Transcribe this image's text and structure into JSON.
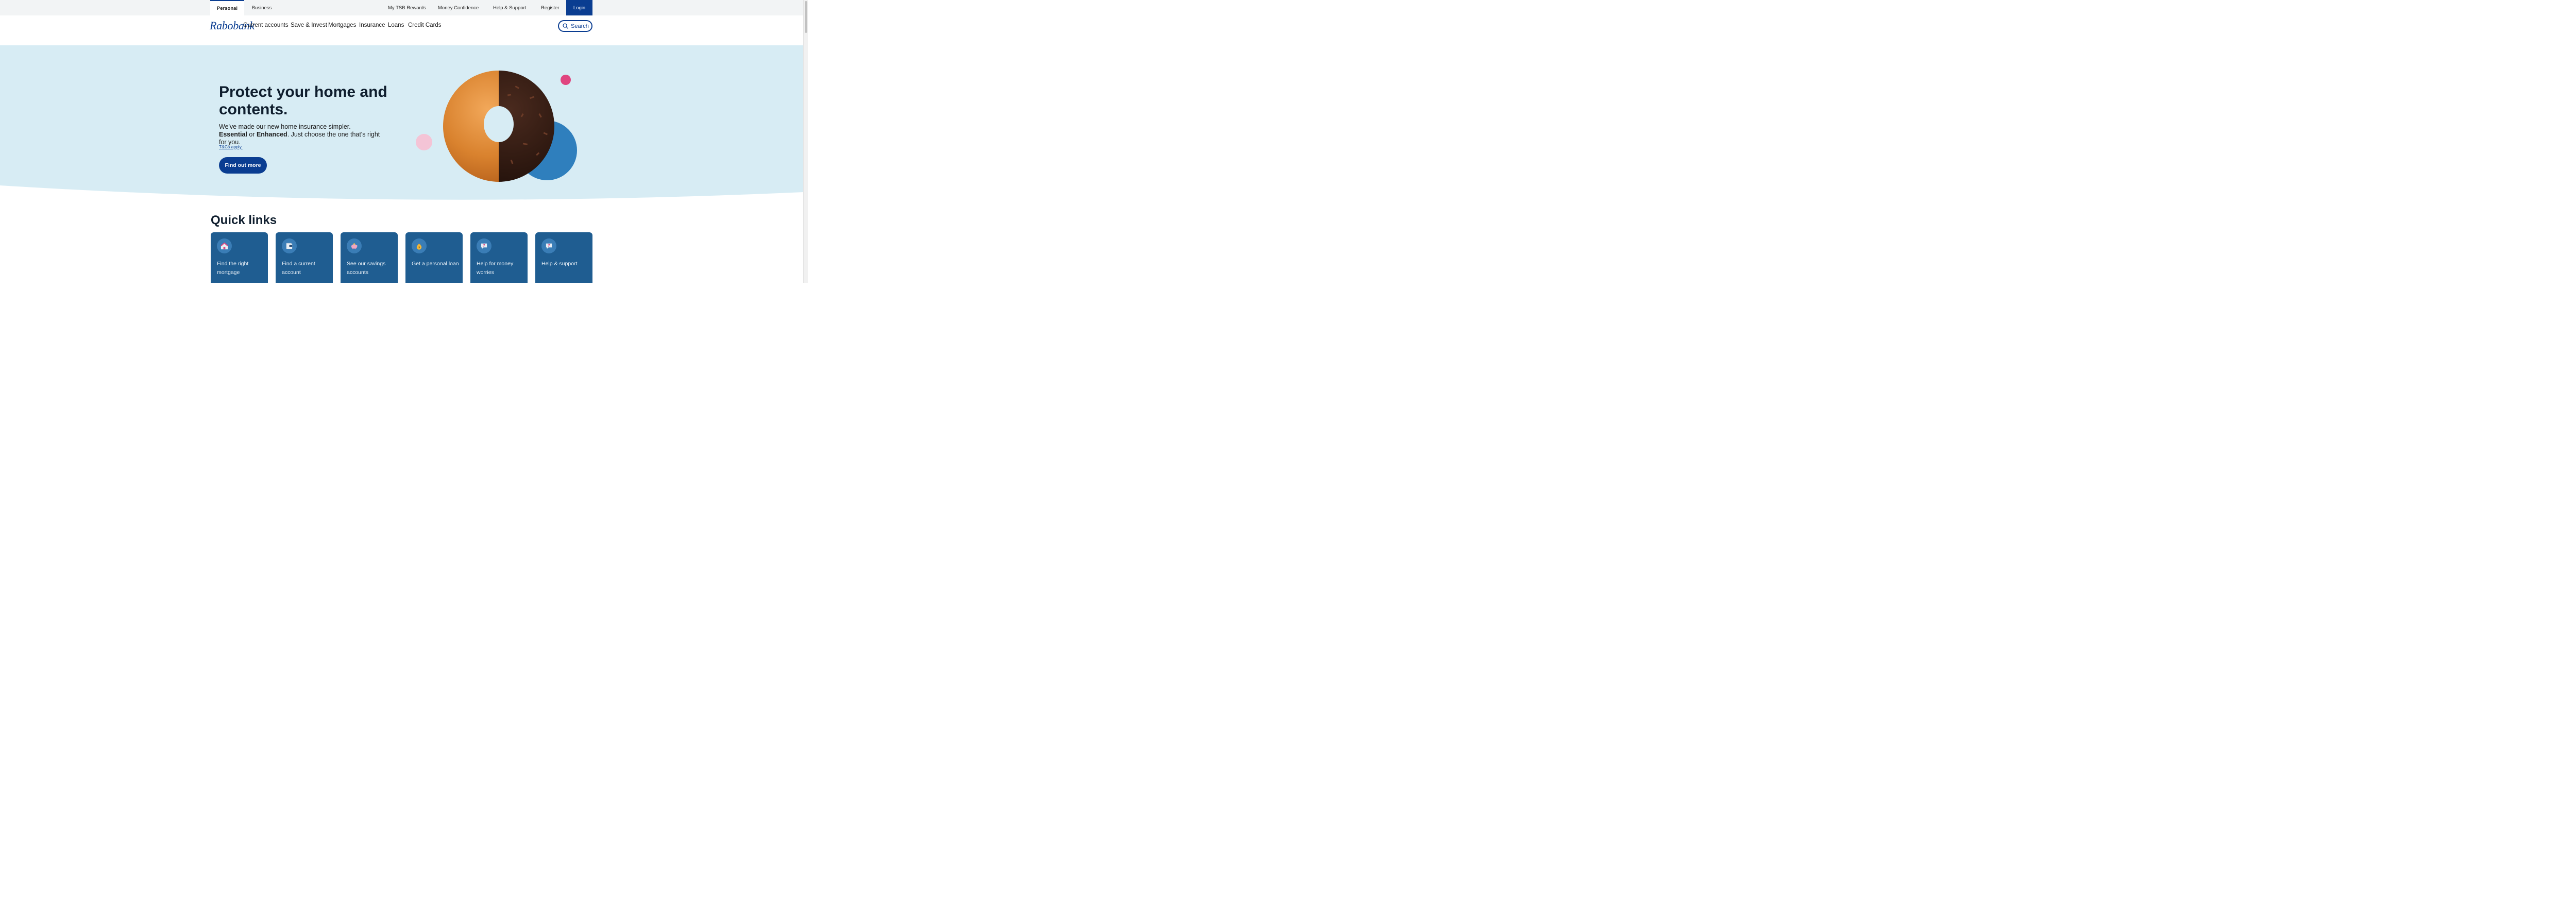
{
  "topbar": {
    "tabs": [
      {
        "label": "Personal",
        "active": true
      },
      {
        "label": "Business",
        "active": false
      }
    ],
    "links": {
      "rewards": "My TSB Rewards",
      "confidence": "Money Confidence",
      "help": "Help & Support",
      "register": "Register",
      "login": "Login"
    }
  },
  "brand": {
    "logo_text": "Rabobank",
    "primary_color": "#0a3d91"
  },
  "nav": {
    "items": [
      "Current accounts",
      "Save & Invest",
      "Mortgages",
      "Insurance",
      "Loans",
      "Credit Cards"
    ],
    "search_label": "Search"
  },
  "hero": {
    "title": "Protect your home and contents.",
    "body_line1": "We've made our new home insurance simpler.",
    "option1": "Essential",
    "or_text": " or ",
    "option2": "Enhanced",
    "body_line2_rest": ". Just choose the one that's right for you.",
    "tcs": "T&Cs apply.",
    "cta": "Find out more",
    "background_color": "#d7ecf4"
  },
  "quick_links": {
    "title": "Quick links",
    "cards": [
      {
        "label": "Find the right mortgage",
        "icon": "house-icon"
      },
      {
        "label": "Find a current account",
        "icon": "wallet-icon"
      },
      {
        "label": "See our savings accounts",
        "icon": "piggy-bank-icon"
      },
      {
        "label": "Get a personal loan",
        "icon": "money-bag-icon"
      },
      {
        "label": "Help for money worries",
        "icon": "question-chat-icon"
      },
      {
        "label": "Help & support",
        "icon": "question-chat-icon"
      }
    ],
    "card_color": "#1f5d91"
  }
}
